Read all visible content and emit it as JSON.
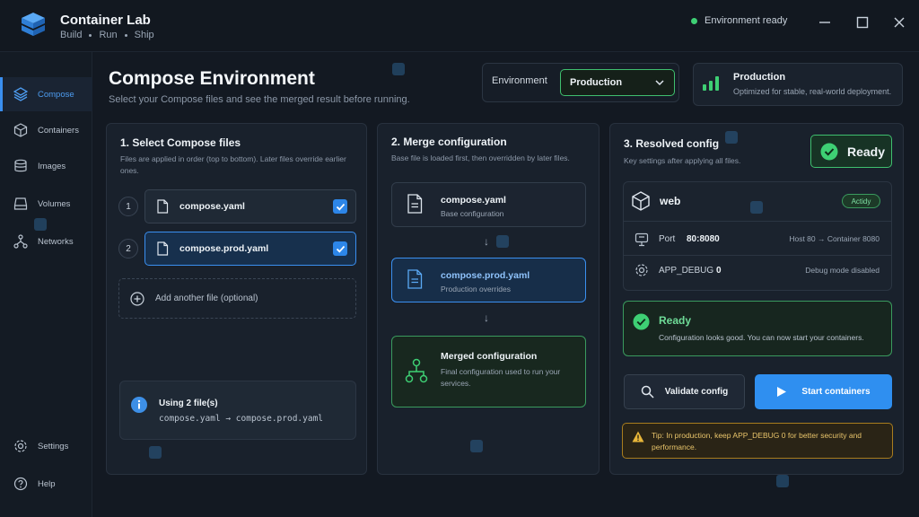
{
  "app": {
    "title": "Container Lab",
    "subtitle": [
      "Build",
      "Run",
      "Ship"
    ],
    "status": "Environment ready"
  },
  "colors": {
    "accent": "#2f8ff0",
    "success": "#3fbf6e",
    "warning": "#e8c46a",
    "background": "#131922"
  },
  "sidebar": {
    "items": [
      {
        "label": "Compose",
        "icon": "layers-icon",
        "active": true
      },
      {
        "label": "Containers",
        "icon": "cube-icon"
      },
      {
        "label": "Images",
        "icon": "database-icon"
      },
      {
        "label": "Volumes",
        "icon": "drive-icon"
      },
      {
        "label": "Networks",
        "icon": "network-icon"
      }
    ],
    "bottom": [
      {
        "label": "Settings",
        "icon": "gear-icon"
      },
      {
        "label": "Help",
        "icon": "help-icon"
      }
    ]
  },
  "header": {
    "title": "Compose Environment",
    "subtitle": "Select your Compose files and see the merged result before running.",
    "environment_label": "Environment",
    "environment_value": "Production",
    "env_card": {
      "title": "Production",
      "description": "Optimized for stable, real-world deployment."
    }
  },
  "select_panel": {
    "title": "1. Select Compose files",
    "description": "Files are applied in order (top to bottom). Later files override earlier ones.",
    "files": [
      {
        "num": "1",
        "name": "compose.yaml",
        "checked": true
      },
      {
        "num": "2",
        "name": "compose.prod.yaml",
        "checked": true
      }
    ],
    "add_label": "Add another file (optional)",
    "summary_title": "Using 2 file(s)",
    "summary_files": "compose.yaml → compose.prod.yaml"
  },
  "merge_panel": {
    "title": "2. Merge configuration",
    "description": "Base file is loaded first, then overridden by later files.",
    "base": {
      "name": "compose.yaml",
      "sub": "Base configuration"
    },
    "override": {
      "name": "compose.prod.yaml",
      "sub": "Production overrides"
    },
    "merged": {
      "name": "Merged configuration",
      "sub": "Final configuration used to run your services."
    }
  },
  "resolved_panel": {
    "title": "3. Resolved config",
    "description": "Key settings after applying all files.",
    "badge": "Ready",
    "service": {
      "name": "web",
      "state": "Actidy"
    },
    "rows": [
      {
        "icon": "port-icon",
        "key": "Port",
        "value": "80:8080",
        "note": "Host 80 → Container 8080"
      },
      {
        "icon": "gear-icon",
        "key": "APP_DEBUG",
        "value": "0",
        "note": "Debug mode disabled"
      }
    ],
    "ready_title": "Ready",
    "ready_text": "Configuration looks good. You can now start your containers.",
    "validate_label": "Validate config",
    "start_label": "Start containers",
    "tip": "Tip: In production, keep APP_DEBUG 0 for better security and performance."
  }
}
